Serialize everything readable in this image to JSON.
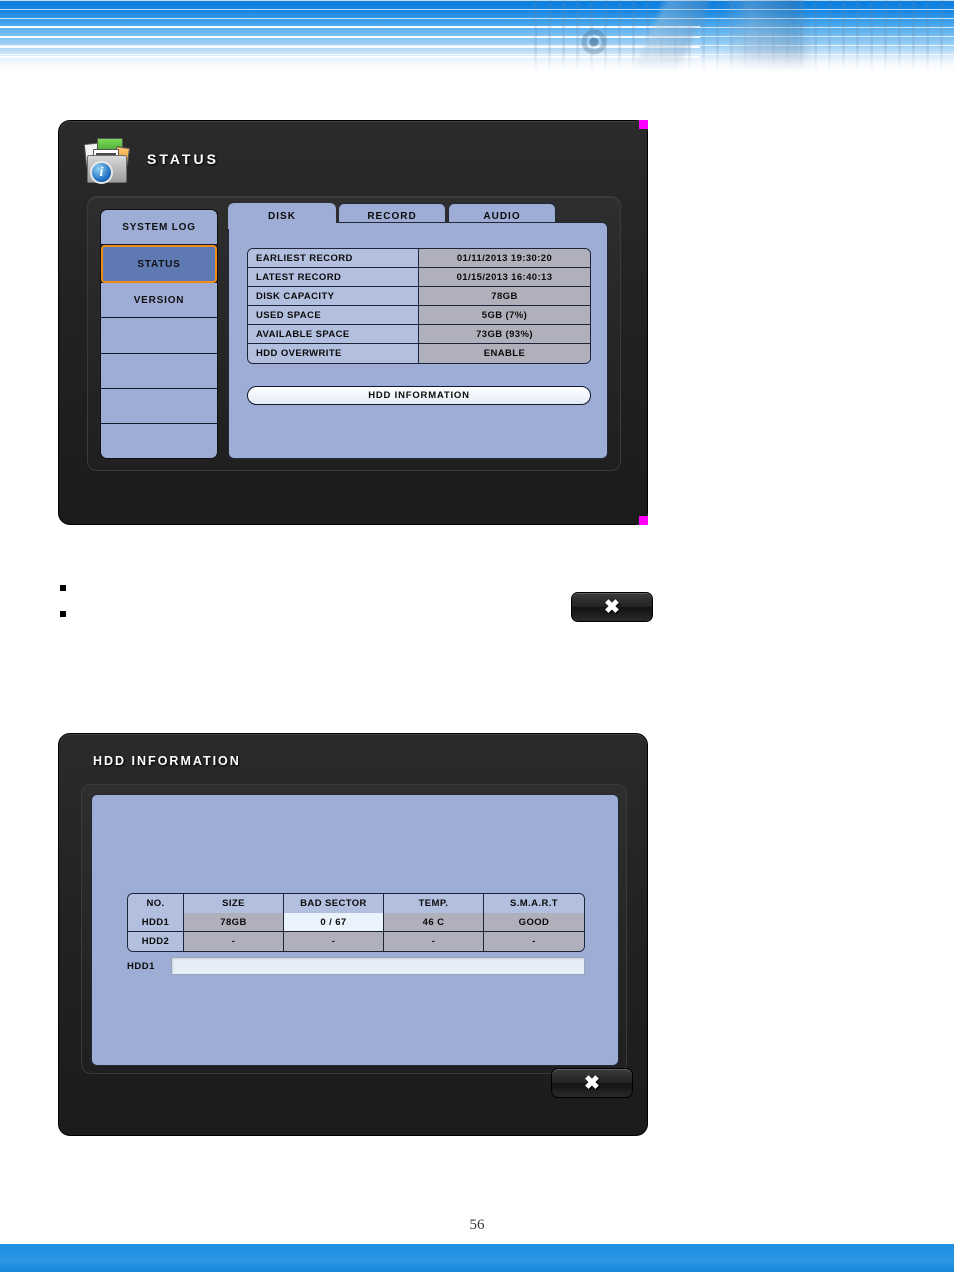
{
  "document": {
    "page_number": "56",
    "bullets": [
      "",
      ""
    ]
  },
  "status_dialog": {
    "title": "STATUS",
    "icon": "document-info-icon",
    "sidebar": {
      "items": [
        {
          "label": "SYSTEM LOG",
          "selected": false
        },
        {
          "label": "STATUS",
          "selected": true
        },
        {
          "label": "VERSION",
          "selected": false
        },
        {
          "label": "",
          "selected": false
        },
        {
          "label": "",
          "selected": false
        },
        {
          "label": "",
          "selected": false
        },
        {
          "label": "",
          "selected": false
        }
      ]
    },
    "tabs": [
      {
        "label": "DISK",
        "active": true
      },
      {
        "label": "RECORD",
        "active": false
      },
      {
        "label": "AUDIO",
        "active": false
      }
    ],
    "disk_table": {
      "rows": [
        {
          "label": "EARLIEST RECORD",
          "value": "01/11/2013 19:30:20"
        },
        {
          "label": "LATEST RECORD",
          "value": "01/15/2013 16:40:13"
        },
        {
          "label": "DISK CAPACITY",
          "value": "78GB"
        },
        {
          "label": "USED SPACE",
          "value": "5GB (7%)"
        },
        {
          "label": "AVAILABLE SPACE",
          "value": "73GB (93%)"
        },
        {
          "label": "HDD OVERWRITE",
          "value": "ENABLE"
        }
      ]
    },
    "hdd_info_button": "HDD INFORMATION",
    "close_button": "✖"
  },
  "hdd_dialog": {
    "title": "HDD INFORMATION",
    "table": {
      "headers": [
        "NO.",
        "SIZE",
        "BAD SECTOR",
        "TEMP.",
        "S.M.A.R.T"
      ],
      "rows": [
        {
          "no": "HDD1",
          "size": "78GB",
          "bad_sector": "0 / 67",
          "temp": "46 C",
          "smart": "GOOD",
          "highlight_cell": "bad_sector"
        },
        {
          "no": "HDD2",
          "size": "-",
          "bad_sector": "-",
          "temp": "-",
          "smart": "-",
          "highlight_cell": ""
        }
      ]
    },
    "bar_label": "HDD1",
    "bar_value": "",
    "close_button": "✖"
  },
  "colors": {
    "panel_blue": "#9dadd6",
    "label_cell": "#b3bfdf",
    "value_cell": "#b0b0bd",
    "selected_item": "#5f7ab3",
    "selection_border": "#f08a19",
    "dialog_dark": "#232323",
    "banner_blue": "#1585e2",
    "footer_blue": "#2a96e4",
    "corner_key": "#ff00ff"
  }
}
